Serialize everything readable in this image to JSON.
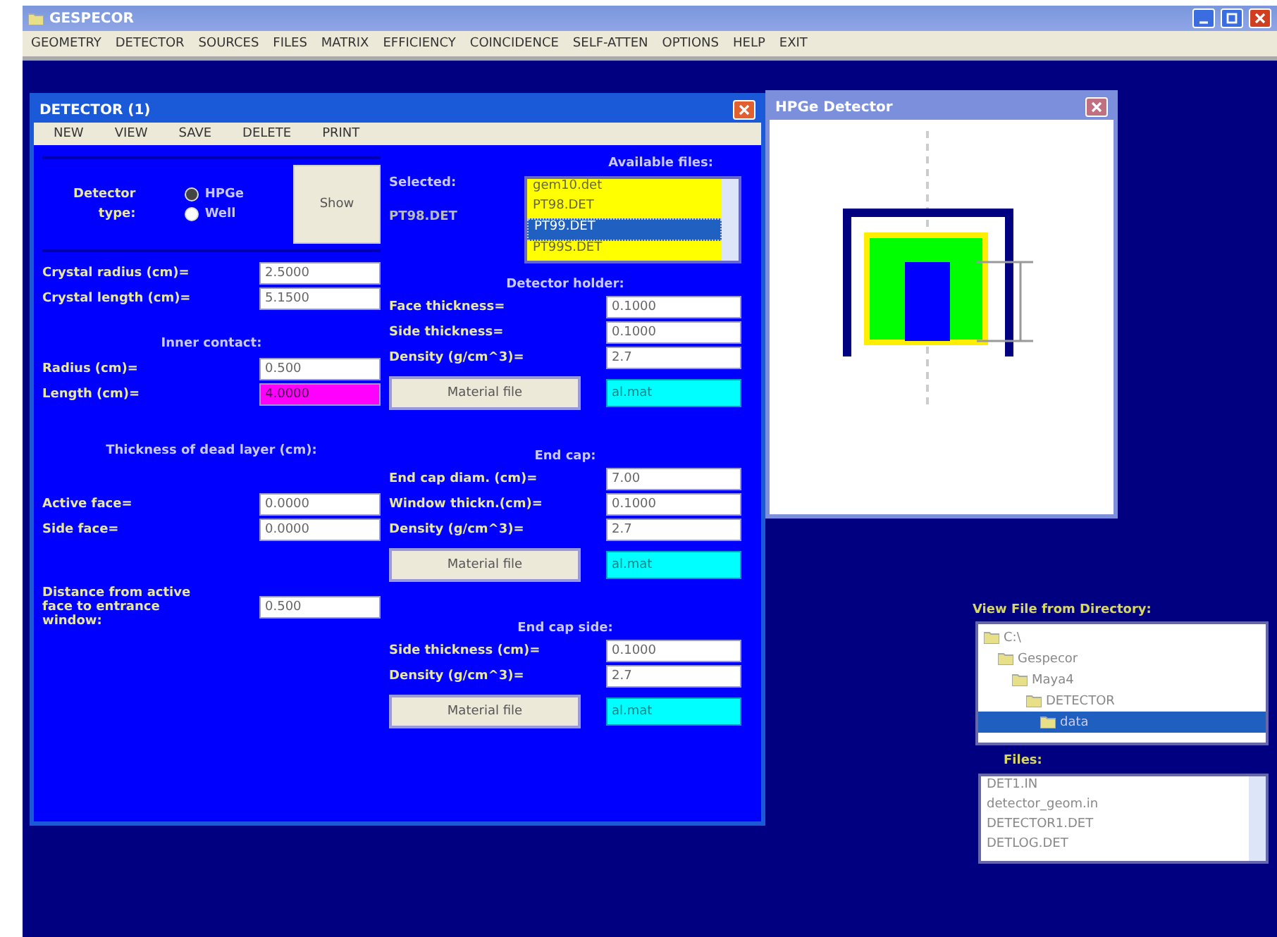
{
  "app": {
    "title": "GESPECOR",
    "menu": [
      "GEOMETRY",
      "DETECTOR",
      "SOURCES",
      "FILES",
      "MATRIX",
      "EFFICIENCY",
      "COINCIDENCE",
      "SELF-ATTEN",
      "OPTIONS",
      "HELP",
      "EXIT"
    ]
  },
  "detector_window": {
    "title": "DETECTOR (1)",
    "menu": [
      "NEW",
      "VIEW",
      "SAVE",
      "DELETE",
      "PRINT"
    ],
    "type_group": {
      "label": "Detector",
      "sublabel": "type:",
      "options": [
        {
          "label": "HPGe",
          "selected": true
        },
        {
          "label": "Well",
          "selected": false
        }
      ],
      "button": "Show"
    },
    "crystal": [
      {
        "label": "Crystal radius (cm)=",
        "value": "2.5000",
        "highlighted": false
      },
      {
        "label": "Crystal length (cm)=",
        "value": "5.1500",
        "highlighted": false
      }
    ],
    "inner_contact": {
      "title": "Inner contact:",
      "fields": [
        {
          "label": "Radius (cm)=",
          "value": "0.500",
          "highlighted": false
        },
        {
          "label": "Length (cm)=",
          "value": "4.0000",
          "highlighted": true
        }
      ]
    },
    "dead_layer": {
      "title": "Thickness of dead layer (cm):",
      "fields": [
        {
          "label": "Active face=",
          "value": "0.0000",
          "highlighted": false
        },
        {
          "label": "Side face=",
          "value": "0.0000",
          "highlighted": false
        }
      ]
    },
    "distance": {
      "label": "Distance from active face to entrance window:",
      "value": "0.500"
    },
    "selected": {
      "label": "Selected:",
      "value": "PT98.DET"
    },
    "available": {
      "title": "Available files:",
      "files": [
        {
          "name": "gem10.det",
          "selected": false
        },
        {
          "name": "PT98.DET",
          "selected": false
        },
        {
          "name": "PT99.DET",
          "selected": true
        },
        {
          "name": "PT99S.DET",
          "selected": false
        }
      ]
    },
    "sections": [
      {
        "title": "Detector holder:",
        "fields": [
          {
            "label": "Face thickness=",
            "value": "0.1000"
          },
          {
            "label": "Side thickness=",
            "value": "0.1000"
          },
          {
            "label": "Density (g/cm^3)=",
            "value": "2.7"
          }
        ],
        "button": "Material file",
        "material": "al.mat"
      },
      {
        "title": "End cap:",
        "fields": [
          {
            "label": "End cap diam. (cm)=",
            "value": "7.00"
          },
          {
            "label": "Window thickn.(cm)=",
            "value": "0.1000"
          },
          {
            "label": "Density (g/cm^3)=",
            "value": "2.7"
          }
        ],
        "button": "Material file",
        "material": "al.mat"
      },
      {
        "title": "End cap side:",
        "fields": [
          {
            "label": "Side thickness (cm)=",
            "value": "0.1000"
          },
          {
            "label": "Density (g/cm^3)=",
            "value": "2.7"
          }
        ],
        "button": "Material file",
        "material": "al.mat"
      }
    ]
  },
  "preview_window": {
    "title": "HPGe Detector"
  },
  "directory": {
    "title": "View File from Directory:",
    "tree": [
      {
        "name": "C:\\",
        "selected": false,
        "children": [
          {
            "name": "Gespecor",
            "selected": false,
            "children": [
              {
                "name": "Maya4",
                "selected": false,
                "children": [
                  {
                    "name": "DETECTOR",
                    "selected": false,
                    "children": [
                      {
                        "name": "data",
                        "selected": true
                      }
                    ]
                  }
                ]
              }
            ]
          }
        ]
      }
    ]
  },
  "files": {
    "title": "Files:",
    "items": [
      "DET1.IN",
      "detector_geom.in",
      "DETECTOR1.DET",
      "DETLOG.DET"
    ]
  }
}
